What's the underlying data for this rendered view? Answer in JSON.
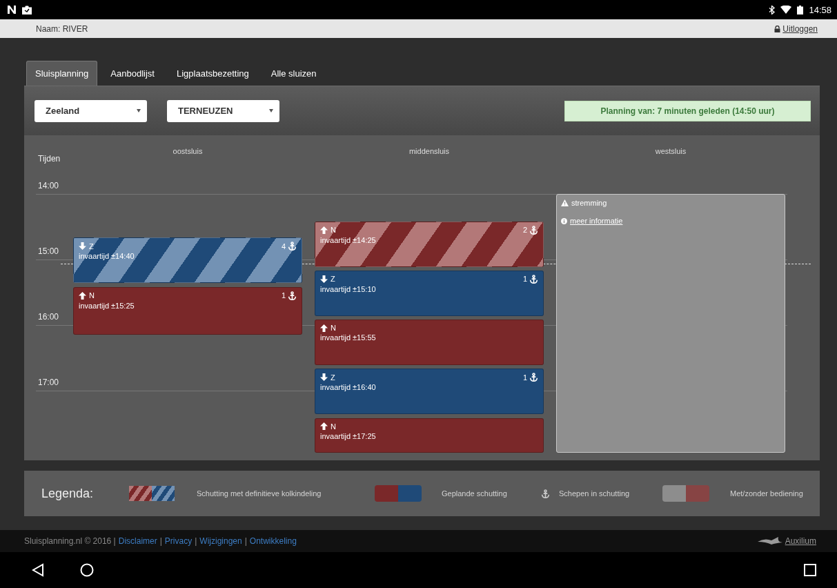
{
  "status_bar": {
    "time": "14:58"
  },
  "header": {
    "user": "Naam: RIVER",
    "logout": "Uitloggen"
  },
  "tabs": [
    {
      "label": "Sluisplanning",
      "selected": true
    },
    {
      "label": "Aanbodlijst",
      "selected": false
    },
    {
      "label": "Ligplaatsbezetting",
      "selected": false
    },
    {
      "label": "Alle sluizen",
      "selected": false
    }
  ],
  "filters": [
    {
      "value": "Zeeland"
    },
    {
      "value": "TERNEUZEN"
    }
  ],
  "planning_notice": "Planning van: 7 minuten geleden (14:50 uur)",
  "schedule": {
    "time_heading": "Tijden",
    "hours": [
      "14:00",
      "15:00",
      "16:00",
      "17:00"
    ],
    "locks": [
      {
        "name": "oostsluis",
        "blocks": [
          {
            "kind": "schutting",
            "northbound": false,
            "heading": "Z",
            "text": "invaartijd ±14:40",
            "ships": "4",
            "striped": true,
            "color": "#1f4a78"
          },
          {
            "kind": "schutting",
            "northbound": true,
            "heading": "N",
            "text": "invaartijd ±15:25",
            "ships": "1",
            "striped": false,
            "color": "#7a2829"
          }
        ]
      },
      {
        "name": "middensluis",
        "blocks": [
          {
            "kind": "schutting",
            "northbound": true,
            "heading": "N",
            "text": "invaartijd ±14:25",
            "ships": "2",
            "striped": true,
            "color": "#7a2829"
          },
          {
            "kind": "schutting",
            "northbound": false,
            "heading": "Z",
            "text": "invaartijd ±15:10",
            "ships": "1",
            "striped": false,
            "color": "#1f4a78"
          },
          {
            "kind": "schutting",
            "northbound": true,
            "heading": "N",
            "text": "invaartijd ±15:55",
            "striped": false,
            "color": "#7a2829"
          },
          {
            "kind": "schutting",
            "northbound": false,
            "heading": "Z",
            "text": "invaartijd ±16:40",
            "ships": "1",
            "striped": false,
            "color": "#1f4a78"
          },
          {
            "kind": "schutting",
            "northbound": true,
            "heading": "N",
            "text": "invaartijd ±17:25",
            "striped": false,
            "color": "#7a2829"
          }
        ]
      },
      {
        "name": "westsluis",
        "blocks": [
          {
            "kind": "stremming",
            "title": "stremming",
            "link": "meer informatie"
          }
        ]
      }
    ]
  },
  "legend": {
    "title": "Legenda:",
    "items": [
      {
        "kind": "striped",
        "text": "Schutting met definitieve kolkindeling"
      },
      {
        "kind": "planned",
        "text": "Geplande schutting"
      },
      {
        "kind": "ships",
        "text": "Schepen in schutting"
      },
      {
        "kind": "service",
        "text": "Met/zonder bediening"
      }
    ]
  },
  "footer": {
    "parts": [
      {
        "text": "Sluisplanning.nl © 2016 |",
        "link": false
      },
      {
        "text": "Disclaimer",
        "link": true
      },
      {
        "text": "|",
        "link": false
      },
      {
        "text": "Privacy",
        "link": true
      },
      {
        "text": "|",
        "link": false
      },
      {
        "text": "Wijzigingen",
        "link": true
      },
      {
        "text": "|",
        "link": false
      },
      {
        "text": "Ontwikkeling",
        "link": true
      }
    ],
    "logo": "Auxilium"
  }
}
